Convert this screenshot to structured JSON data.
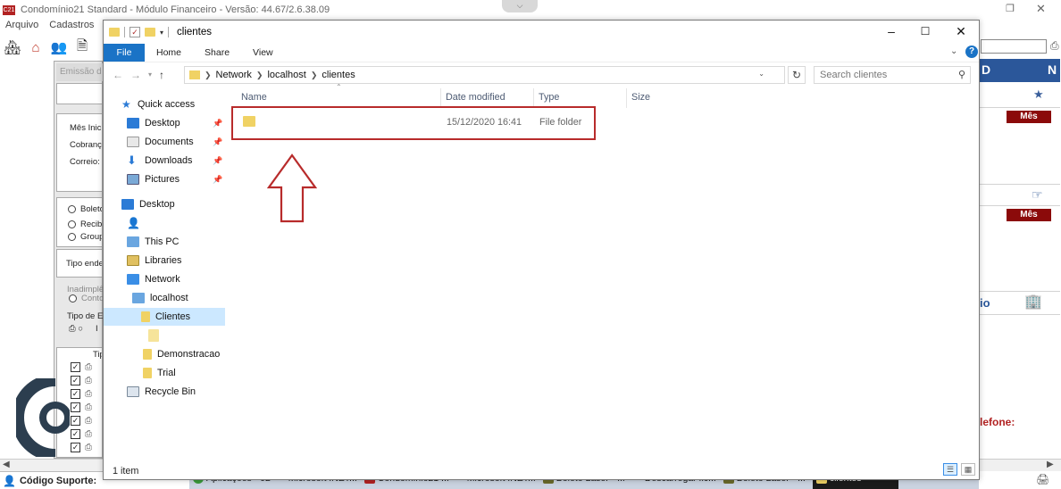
{
  "background_app": {
    "title": "Condomínio21 Standard - Módulo Financeiro - Versão: 44.67/2.6.38.09",
    "logo": "C21",
    "menu": [
      "Arquivo",
      "Cadastros"
    ],
    "left_panel": {
      "tab": "Emissão d",
      "labels": [
        "Mês Inici",
        "Cobrança",
        "Correio:",
        "Boleto",
        "Recibo",
        "Group",
        "Tipo ende",
        "Inadimplê",
        "Conto",
        "Tipo de E",
        "Tip"
      ],
      "print_radio": "I"
    },
    "right_panel": {
      "banner_left": "D",
      "banner_right": "N",
      "mes_buttons": [
        "Mês",
        "Mês"
      ],
      "label_io": "io",
      "label_telefone": "lefone:"
    },
    "status": {
      "label": "Código Suporte:"
    }
  },
  "taskbar": {
    "items": [
      {
        "label": "Aplicações - 02",
        "color": "#3a9a3a"
      },
      {
        "label": "Microsoft .NET...",
        "color": ""
      },
      {
        "label": "Condomínio21 ...",
        "color": "#b22222"
      },
      {
        "label": "Microsoft .NET...",
        "color": ""
      },
      {
        "label": "Boleto Laser - ...",
        "color": "#6b6b2b"
      },
      {
        "label": "Descarregar fic...",
        "color": ""
      },
      {
        "label": "Boleto Laser - ...",
        "color": "#6b6b2b"
      },
      {
        "label": "clientes",
        "color": "#f0d264"
      }
    ]
  },
  "explorer": {
    "window_title": "clientes",
    "ribbon_tabs": [
      "File",
      "Home",
      "Share",
      "View"
    ],
    "address": {
      "crumbs": [
        "Network",
        "localhost",
        "clientes"
      ]
    },
    "search_placeholder": "Search clientes",
    "columns": [
      "Name",
      "Date modified",
      "Type",
      "Size"
    ],
    "files": [
      {
        "name": "",
        "date_modified": "15/12/2020 16:41",
        "type": "File folder",
        "size": ""
      }
    ],
    "nav": {
      "quick_access": "Quick access",
      "desktop": "Desktop",
      "documents": "Documents",
      "downloads": "Downloads",
      "pictures": "Pictures",
      "desktop2": "Desktop",
      "user": "",
      "this_pc": "This PC",
      "libraries": "Libraries",
      "network": "Network",
      "localhost": "localhost",
      "clientes": "Clientes",
      "subfolder": "",
      "demonstracao": "Demonstracao",
      "trial": "Trial",
      "recycle_bin": "Recycle Bin"
    },
    "status_text": "1 item"
  }
}
